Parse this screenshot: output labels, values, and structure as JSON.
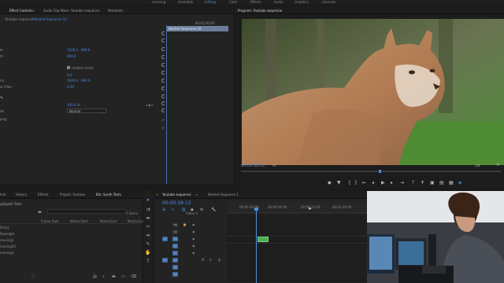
{
  "workspaces": [
    "Learning",
    "Assembly",
    "Editing",
    "Color",
    "Effects",
    "Audio",
    "Graphics",
    "Libraries"
  ],
  "source_panel": {
    "tabs": [
      "Effect Controls",
      "Audio Clip Mixer: Youtube sequence",
      "Metadata"
    ],
    "breadcrumb": [
      "Youtube sequence",
      "* Nested Sequence 10"
    ],
    "clip_label": "Nested Sequence 10",
    "timecode": "00;01;00;00",
    "values": {
      "position": [
        "1920.0",
        "960.0"
      ],
      "scale": "400.0",
      "uniform_scale": "Uniform Scale",
      "rotation": "0.0",
      "anchor": [
        "1920.0",
        "960.0"
      ],
      "flicker": "0.00",
      "opacity": "100.0 %",
      "blend_mode": "Normal"
    },
    "row_fragments": [
      "le",
      "th",
      "",
      "",
      "nd",
      "er Filter",
      "",
      "",
      "de",
      "ping"
    ]
  },
  "program": {
    "title": "Program: Youtube sequence",
    "timecode": "00:00:58:12",
    "fit": "Fit",
    "quality": "1/8"
  },
  "project_panel": {
    "tabs": [
      "Info",
      "History",
      "Effects",
      "Project: Youtube",
      "Bin: Synth Tests"
    ],
    "bin_path": "opSynth Tests",
    "item_count": "5 Items",
    "columns": [
      "Frame Rate",
      "Media Start",
      "Media End",
      "Media Dur"
    ],
    "items": [
      "Dela1",
      "flyweight",
      "moving1",
      "moving02",
      "moving3"
    ]
  },
  "timeline": {
    "tabs": [
      "Youtube sequence",
      "Nested Sequence 1"
    ],
    "timecode": "00:00:58:12",
    "ruler": [
      "00:00:00:00",
      "00:00:04:00",
      "00:01:12:00",
      "00:01:20:00",
      "00:01:28:00"
    ],
    "video_tracks": [
      "V5",
      "V4",
      "V3",
      "V2",
      "V1"
    ],
    "audio_tracks": [
      "A1",
      "A2",
      "A3"
    ],
    "video_label": "Video 4"
  },
  "colors": {
    "accent": "#4a8ee0",
    "panel": "#232323",
    "clip_green": "#4caf50"
  }
}
